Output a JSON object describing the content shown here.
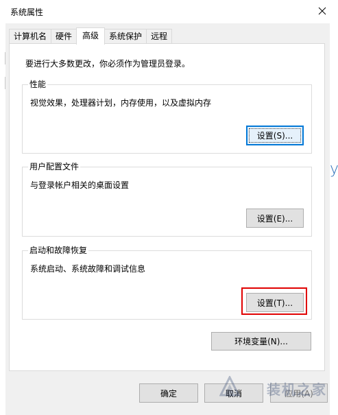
{
  "window": {
    "title": "系统属性"
  },
  "tabs": [
    {
      "label": "计算机名"
    },
    {
      "label": "硬件"
    },
    {
      "label": "高级"
    },
    {
      "label": "系统保护"
    },
    {
      "label": "远程"
    }
  ],
  "panel": {
    "admin_note": "要进行大多数更改，你必须作为管理员登录。",
    "performance": {
      "title": "性能",
      "description": "视觉效果，处理器计划，内存使用，以及虚拟内存",
      "button": "设置(S)..."
    },
    "user_profiles": {
      "title": "用户配置文件",
      "description": "与登录帐户相关的桌面设置",
      "button": "设置(E)..."
    },
    "startup_recovery": {
      "title": "启动和故障恢复",
      "description": "系统启动、系统故障和调试信息",
      "button": "设置(T)..."
    },
    "env_button": "环境变量(N)..."
  },
  "footer": {
    "ok": "确定",
    "cancel": "取消",
    "apply": "应用(A)"
  },
  "watermark": {
    "text": "装机之家"
  },
  "background": {
    "ys_fragment": "ys"
  }
}
